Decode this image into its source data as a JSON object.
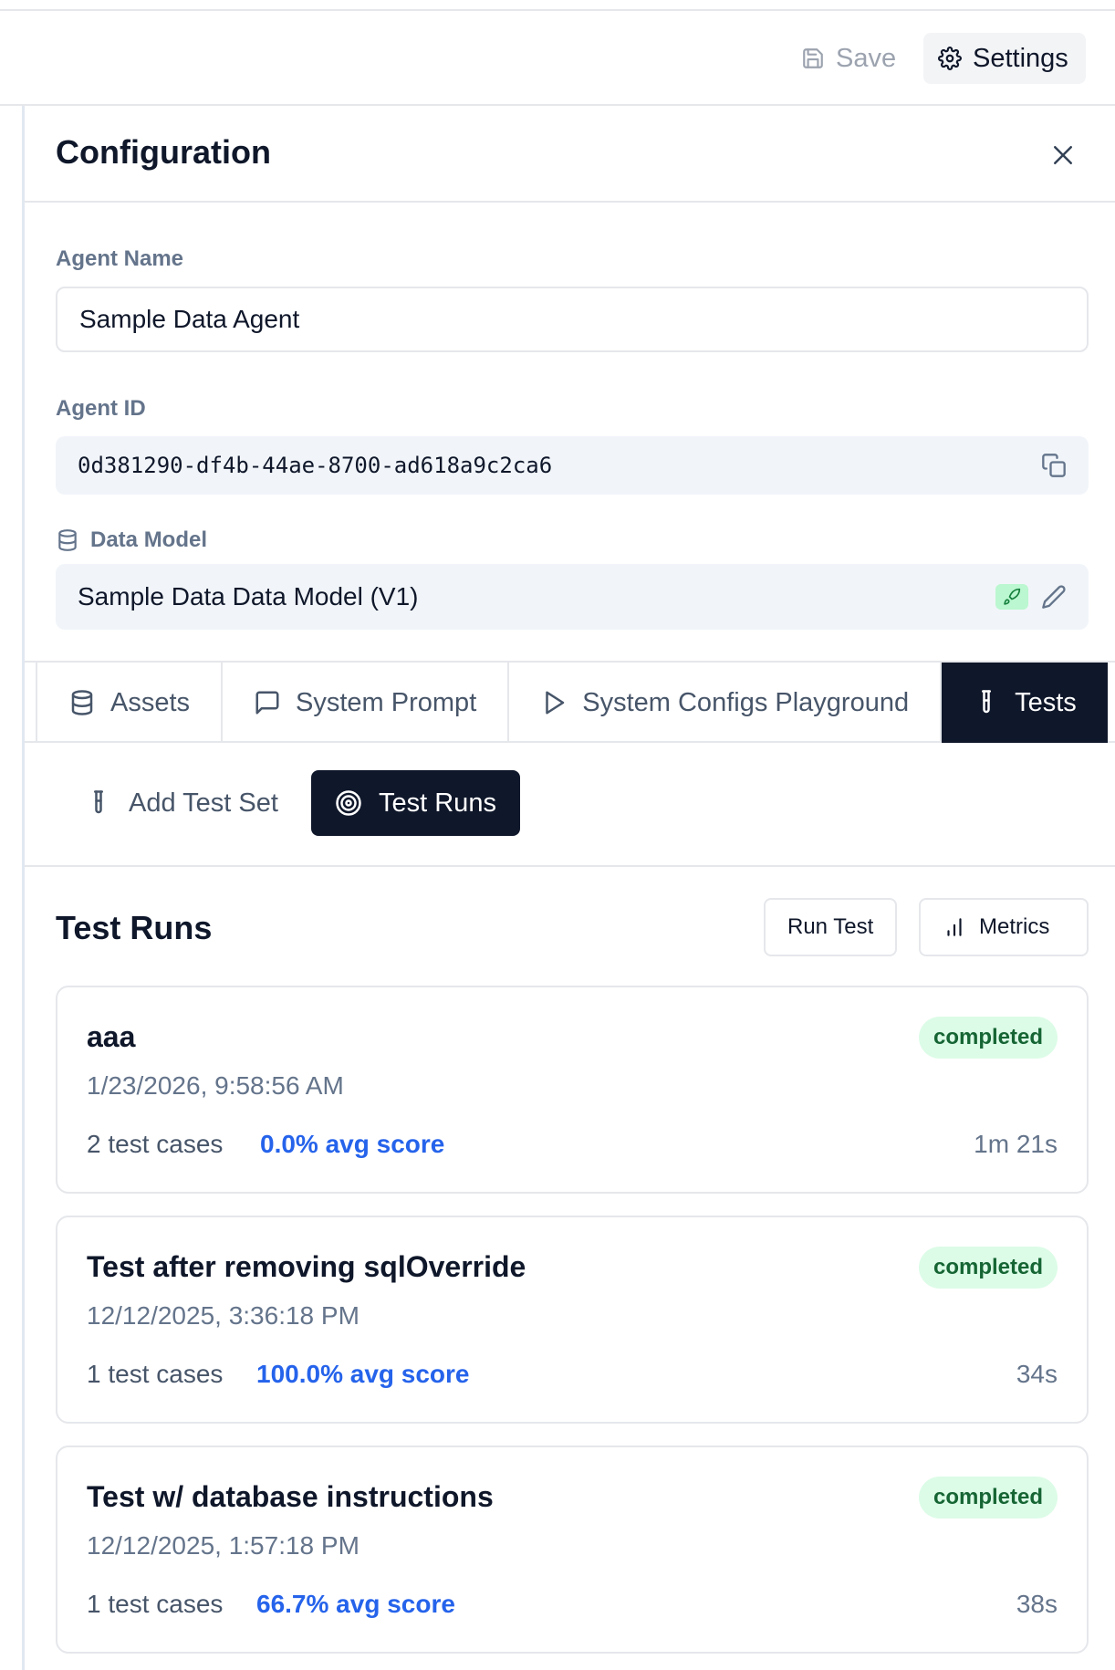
{
  "toolbar": {
    "save_label": "Save",
    "settings_label": "Settings"
  },
  "panel": {
    "title": "Configuration"
  },
  "fields": {
    "agent_name_label": "Agent Name",
    "agent_name_value": "Sample Data Agent",
    "agent_id_label": "Agent ID",
    "agent_id_value": "0d381290-df4b-44ae-8700-ad618a9c2ca6",
    "data_model_label": "Data Model",
    "data_model_value": "Sample Data Data Model (V1)"
  },
  "tabs": [
    {
      "label": "Assets",
      "icon": "database-icon"
    },
    {
      "label": "System Prompt",
      "icon": "message-square-icon"
    },
    {
      "label": "System Configs Playground",
      "icon": "play-icon"
    },
    {
      "label": "Tests",
      "icon": "test-tube-icon",
      "active": true
    }
  ],
  "subtabs": [
    {
      "label": "Add Test Set",
      "icon": "test-tube-icon"
    },
    {
      "label": "Test Runs",
      "icon": "target-icon",
      "active": true
    }
  ],
  "test_runs": {
    "title": "Test Runs",
    "run_test_label": "Run Test",
    "metrics_label": "Metrics",
    "items": [
      {
        "name": "aaa",
        "date": "1/23/2026, 9:58:56 AM",
        "cases": "2 test cases",
        "score": "0.0% avg score",
        "duration": "1m 21s",
        "status": "completed"
      },
      {
        "name": "Test after removing sqlOverride",
        "date": "12/12/2025, 3:36:18 PM",
        "cases": "1 test cases",
        "score": "100.0% avg score",
        "duration": "34s",
        "status": "completed"
      },
      {
        "name": "Test w/ database instructions",
        "date": "12/12/2025, 1:57:18 PM",
        "cases": "1 test cases",
        "score": "66.7% avg score",
        "duration": "38s",
        "status": "completed"
      }
    ]
  },
  "colors": {
    "accent_dark": "#0f172a",
    "score_blue": "#2563eb",
    "badge_green_bg": "#dcfce7",
    "badge_green_text": "#166534"
  }
}
